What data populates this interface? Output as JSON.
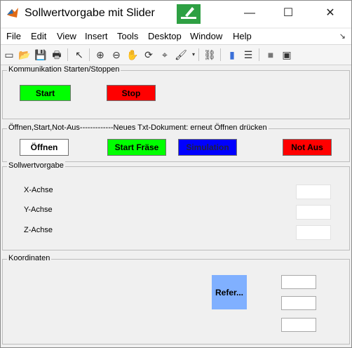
{
  "window": {
    "title": "Sollwertvorgabe mit Slider",
    "controls": {
      "minimize": "—",
      "maximize": "☐",
      "close": "✕"
    }
  },
  "menu": [
    "File",
    "Edit",
    "View",
    "Insert",
    "Tools",
    "Desktop",
    "Window",
    "Help"
  ],
  "menu_arrow": "↘",
  "toolbar": {
    "icons": [
      "new-file-icon",
      "open-folder-icon",
      "save-icon",
      "print-icon",
      "pointer-icon",
      "zoom-in-icon",
      "zoom-out-icon",
      "pan-hand-icon",
      "rotate-3d-icon",
      "data-cursor-icon",
      "brush-icon",
      "link-icon",
      "colorbar-icon",
      "legend-icon",
      "hide-plot-tools-icon",
      "show-plot-tools-icon"
    ],
    "glyphs": [
      "▭",
      "📂",
      "💾",
      "🖶",
      "↖",
      "⊕",
      "⊖",
      "✋",
      "⟳",
      "⌖",
      "🖌",
      "⛓",
      "▮",
      "☰",
      "■",
      "▣"
    ]
  },
  "panels": {
    "comm": {
      "title": "Kommunikation Starten/Stoppen",
      "start_label": "Start",
      "stop_label": "Stop"
    },
    "open": {
      "title": "Öffnen,Start,Not-Aus-------------Neues Txt-Dokument: erneut Öffnen drücken",
      "open_label": "Öffnen",
      "start_mill_label": "Start Fräse",
      "simulation_label": "Simulation",
      "emergency_label": "Not Aus"
    },
    "setpoint": {
      "title": "Sollwertvorgabe",
      "x_label": "X-Achse",
      "y_label": "Y-Achse",
      "z_label": "Z-Achse"
    },
    "coords": {
      "title": "Koordinaten",
      "refer_label": "Refer..."
    }
  },
  "colors": {
    "green": "#00ff00",
    "red": "#ff0000",
    "blue": "#0000ff",
    "light_blue": "#80b0ff"
  }
}
